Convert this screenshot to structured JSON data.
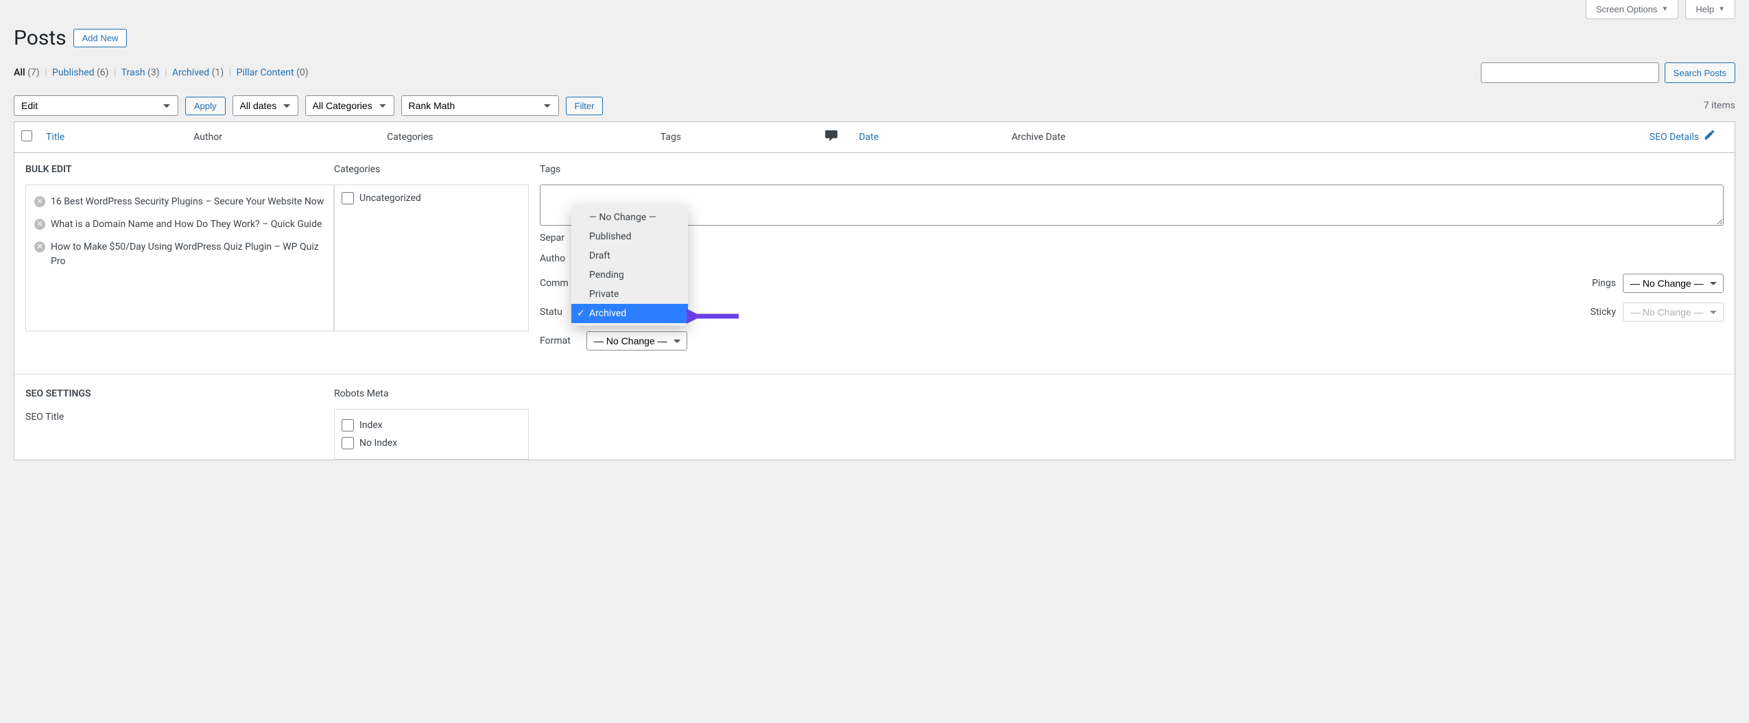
{
  "topTabs": {
    "screenOptions": "Screen Options",
    "help": "Help"
  },
  "page": {
    "title": "Posts",
    "addNew": "Add New"
  },
  "filters": {
    "items": [
      {
        "label": "All",
        "count": "(7)",
        "current": true
      },
      {
        "label": "Published",
        "count": "(6)"
      },
      {
        "label": "Trash",
        "count": "(3)"
      },
      {
        "label": "Archived",
        "count": "(1)"
      },
      {
        "label": "Pillar Content",
        "count": "(0)"
      }
    ]
  },
  "search": {
    "button": "Search Posts",
    "placeholder": ""
  },
  "tablenav": {
    "bulkAction": "Edit",
    "apply": "Apply",
    "dates": "All dates",
    "categories": "All Categories",
    "seoFilter": "Rank Math",
    "filter": "Filter",
    "itemsCount": "7 items"
  },
  "columns": {
    "title": "Title",
    "author": "Author",
    "categories": "Categories",
    "tags": "Tags",
    "date": "Date",
    "archiveDate": "Archive Date",
    "seoDetails": "SEO Details"
  },
  "bulkEdit": {
    "heading": "BULK EDIT",
    "categoriesHeading": "Categories",
    "tagsHeading": "Tags",
    "posts": [
      "16 Best WordPress Security Plugins – Secure Your Website Now",
      "What is a Domain Name and How Do They Work? – Quick Guide",
      "How to Make $50/Day Using WordPress Quiz Plugin – WP Quiz Pro"
    ],
    "uncategorized": "Uncategorized",
    "separateHint": "Separ",
    "labels": {
      "author": "Autho",
      "comments": "Comm",
      "status": "Statu",
      "format": "Format",
      "pings": "Pings",
      "sticky": "Sticky"
    },
    "noChange": "— No Change —",
    "statusOptions": [
      "— No Change —",
      "Published",
      "Draft",
      "Pending",
      "Private",
      "Archived"
    ],
    "statusSelected": "Archived"
  },
  "seoSection": {
    "heading": "SEO SETTINGS",
    "seoTitle": "SEO Title",
    "robotsMeta": "Robots Meta",
    "robotsOptions": [
      "Index",
      "No Index"
    ]
  }
}
